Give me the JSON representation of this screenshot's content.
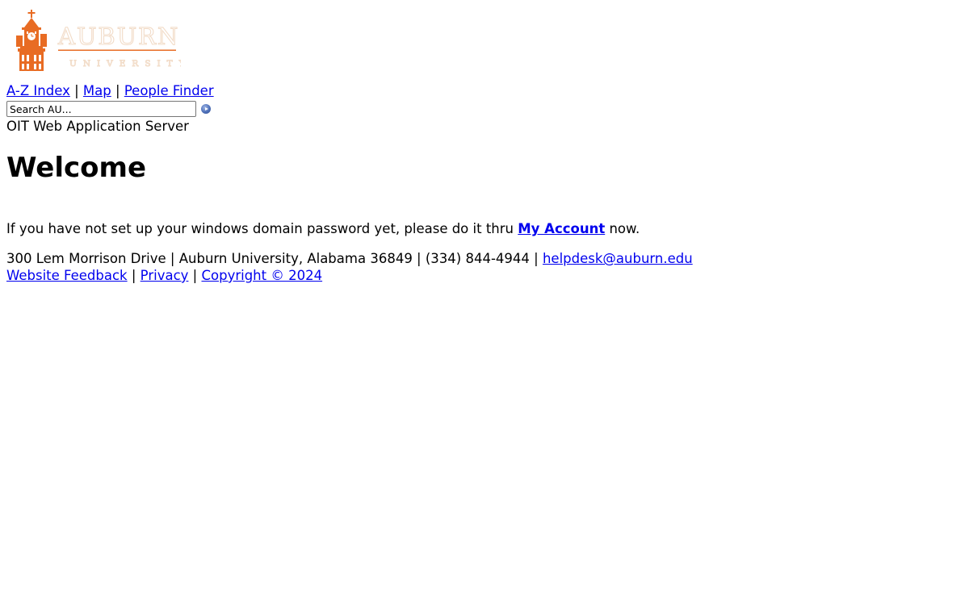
{
  "brand": {
    "wordmark_top": "AUBURN",
    "wordmark_bottom": "UNIVERSITY",
    "color": "#e86c24"
  },
  "top_nav": {
    "items": [
      {
        "label": "A-Z Index"
      },
      {
        "label": "Map"
      },
      {
        "label": "People Finder"
      }
    ],
    "separator": " | "
  },
  "search": {
    "placeholder": "Search AU...",
    "submit_icon": "go-arrow-icon"
  },
  "header": {
    "server_name": "OIT Web Application Server"
  },
  "main": {
    "title": "Welcome",
    "notice_prefix": "If you have not set up your windows domain password yet, please do it thru ",
    "notice_link": "My Account",
    "notice_suffix": " now."
  },
  "footer": {
    "address": "300 Lem Morrison Drive | Auburn University, Alabama 36849 | (334) 844-4944 | ",
    "email": "helpdesk@auburn.edu",
    "links": [
      {
        "label": "Website Feedback"
      },
      {
        "label": "Privacy"
      },
      {
        "label": "Copyright © 2024"
      }
    ],
    "separator": " | "
  },
  "colors": {
    "link": "#0000ee",
    "text": "#000000",
    "background": "#ffffff"
  }
}
